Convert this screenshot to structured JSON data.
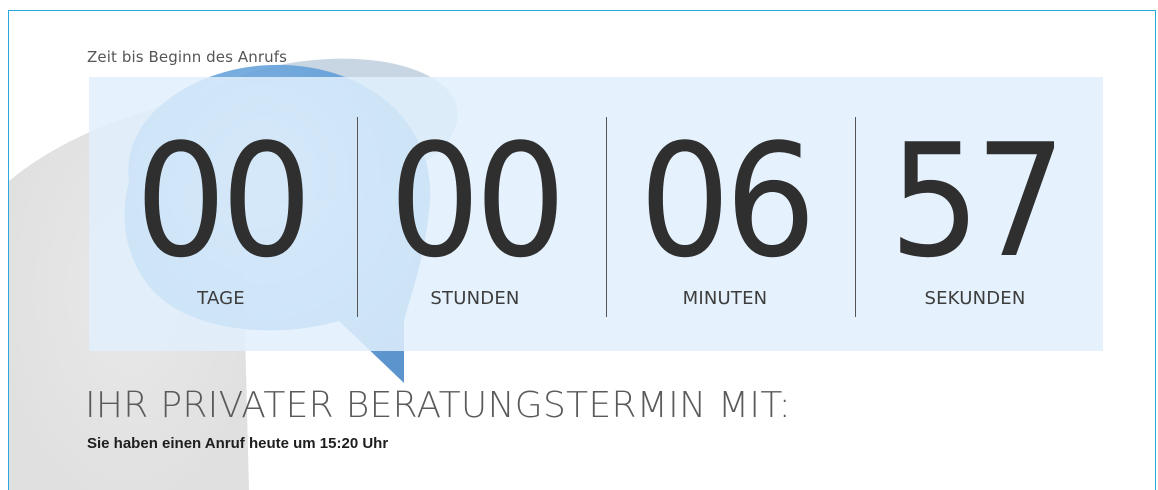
{
  "caption": "Zeit bis Beginn des Anrufs",
  "countdown": {
    "units": [
      {
        "value": "00",
        "label": "TAGE"
      },
      {
        "value": "00",
        "label": "STUNDEN"
      },
      {
        "value": "06",
        "label": "MINUTEN"
      },
      {
        "value": "57",
        "label": "SEKUNDEN"
      }
    ]
  },
  "heading": "IHR PRIVATER BERATUNGSTERMIN MIT:",
  "subline": "Sie haben einen Anruf heute um 15:20 Uhr",
  "colors": {
    "frame_border": "#29a8e0",
    "panel_bg": "#e1f0fd",
    "bubble_blue": "#5b9bd5",
    "digit": "#2f2f2f"
  },
  "icons": {
    "background": "speech-bubble-icon"
  }
}
